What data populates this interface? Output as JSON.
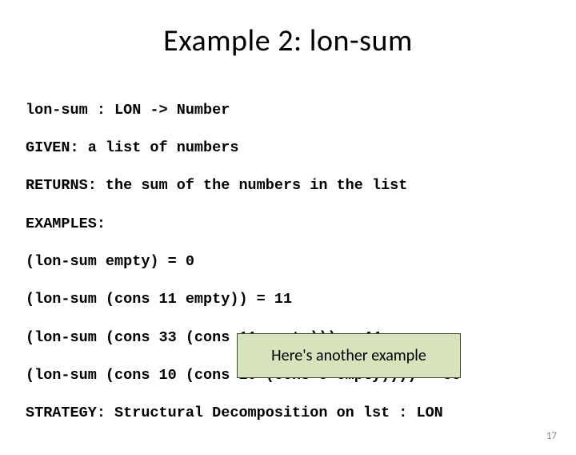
{
  "title": "Example 2: lon-sum",
  "code": {
    "l1": "lon-sum : LON -> Number",
    "l2": "GIVEN: a list of numbers",
    "l3": "RETURNS: the sum of the numbers in the list",
    "l4": "EXAMPLES:",
    "l5": "(lon-sum empty) = 0",
    "l6": "(lon-sum (cons 11 empty)) = 11",
    "l7": "(lon-sum (cons 33 (cons 11 empty))) = 44",
    "l8": "(lon-sum (cons 10 (cons 20 (cons 3 empty)))) = 33",
    "l9": "STRATEGY: Structural Decomposition on lst : LON"
  },
  "callout": "Here's another example",
  "pageNumber": "17"
}
